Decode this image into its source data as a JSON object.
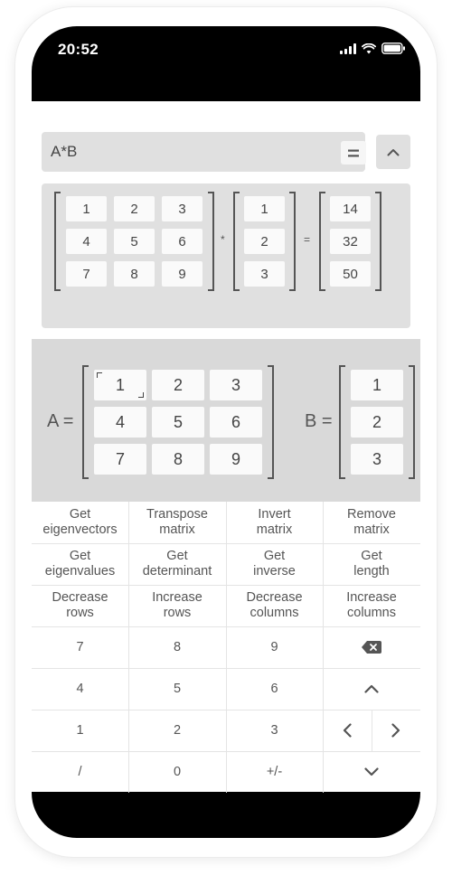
{
  "status": {
    "time": "20:52"
  },
  "expression": {
    "text": "A*B",
    "equals_icon": "=",
    "collapse_icon": "chevron-up"
  },
  "result": {
    "matrix_a": [
      [
        "1",
        "2",
        "3"
      ],
      [
        "4",
        "5",
        "6"
      ],
      [
        "7",
        "8",
        "9"
      ]
    ],
    "operator": "*",
    "matrix_b": [
      [
        "1"
      ],
      [
        "2"
      ],
      [
        "3"
      ]
    ],
    "equals": "=",
    "matrix_c": [
      [
        "14"
      ],
      [
        "32"
      ],
      [
        "50"
      ]
    ]
  },
  "editor": {
    "a_label": "A =",
    "b_label": "B =",
    "matrix_a": [
      [
        "1",
        "2",
        "3"
      ],
      [
        "4",
        "5",
        "6"
      ],
      [
        "7",
        "8",
        "9"
      ]
    ],
    "matrix_b": [
      [
        "1"
      ],
      [
        "2"
      ],
      [
        "3"
      ]
    ],
    "active_cell": "a-0-0"
  },
  "keypad": {
    "functions": [
      [
        "Get\neigenvectors",
        "Transpose\nmatrix",
        "Invert\nmatrix",
        "Remove\nmatrix"
      ],
      [
        "Get\neigenvalues",
        "Get\ndeterminant",
        "Get\ninverse",
        "Get\nlength"
      ],
      [
        "Decrease\nrows",
        "Increase\nrows",
        "Decrease\ncolumns",
        "Increase\ncolumns"
      ]
    ],
    "digits": [
      [
        "7",
        "8",
        "9"
      ],
      [
        "4",
        "5",
        "6"
      ],
      [
        "1",
        "2",
        "3"
      ],
      [
        "/",
        "0",
        "+/-"
      ]
    ],
    "side_icons": [
      "backspace-icon",
      "chevron-up-icon",
      "chevron-left-icon",
      "chevron-right-icon",
      "chevron-down-icon"
    ]
  },
  "colors": {
    "panel": "#e0e0e0",
    "editor": "#d9d9d9",
    "cell": "#fafafa",
    "frame": "#000000"
  }
}
